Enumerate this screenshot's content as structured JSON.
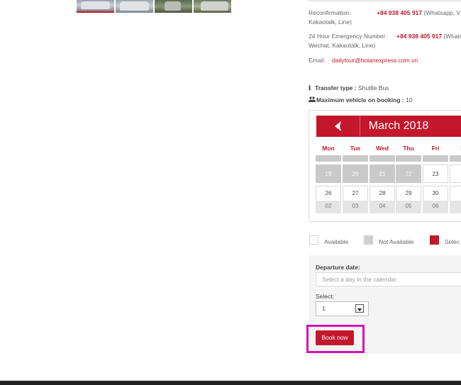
{
  "thumbnails": [
    "van-photo-1",
    "van-photo-2",
    "van-photo-3",
    "van-photo-4"
  ],
  "contact": {
    "reconfirmation_label": "Reconfirmation:",
    "reconfirmation_phone": "+84 938 405 917",
    "reconfirmation_note": "(Whatsapp, V",
    "reconfirmation_note2": "Kakaotalk, Line)",
    "emergency_label": "24 Hour Emergency Number:",
    "emergency_phone": "+84 938 405 917",
    "emergency_note": "(Whats",
    "emergency_note2": "Wechat, Kakaotalk, Line)",
    "email_label": "Email:",
    "email": "dailytour@hoianexpress.com.vn"
  },
  "transfer": {
    "type_label": "Transfer type :",
    "type_value": "Shuttle Bus",
    "max_label": "Maximum vehicle on booking :",
    "max_value": "10"
  },
  "calendar": {
    "month": "March 2018",
    "weekdays": [
      "Mon",
      "Tue",
      "Wed",
      "Thu",
      "Fri",
      "S"
    ],
    "row1": [
      "19",
      "20",
      "21",
      "22",
      "23",
      "2"
    ],
    "row2": [
      "26",
      "27",
      "28",
      "29",
      "30",
      "3"
    ],
    "row3": [
      "02",
      "03",
      "04",
      "05",
      "06",
      "0"
    ]
  },
  "legend": {
    "available": "Available",
    "not_available": "Not Available",
    "selected": "Selec"
  },
  "form": {
    "departure_label": "Departure date:",
    "departure_placeholder": "Select a day in the calendar",
    "select_label": "Select:",
    "select_value": "1",
    "book_label": "Book now"
  },
  "colors": {
    "accent": "#c4172c",
    "highlight": "#d413b7"
  }
}
